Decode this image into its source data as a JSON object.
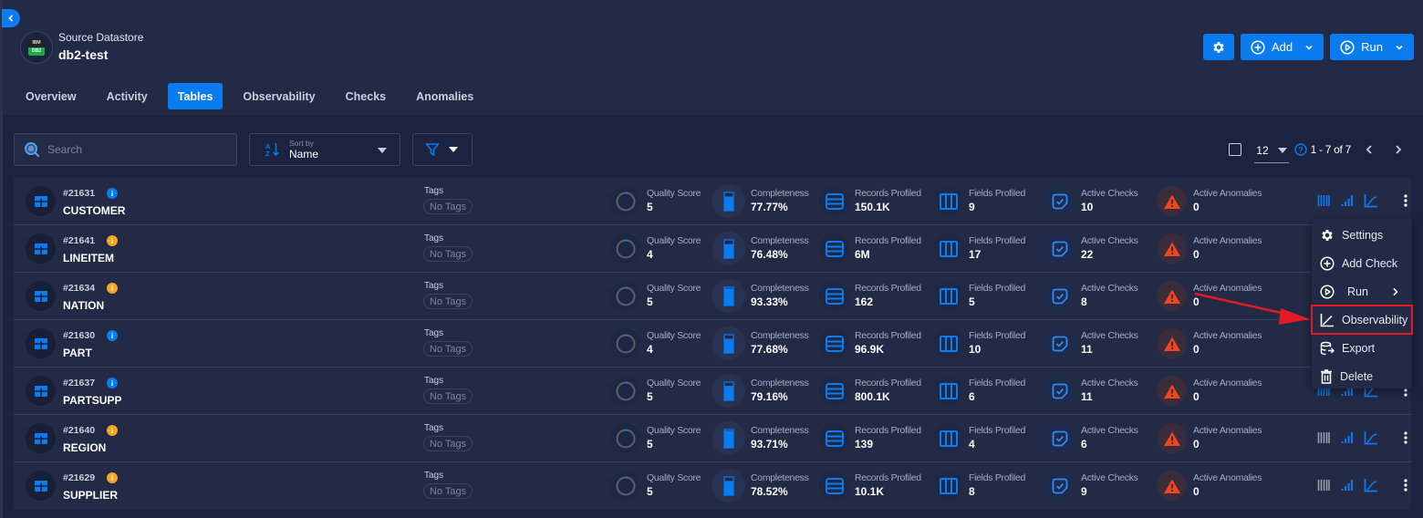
{
  "header": {
    "datastore_label": "Source Datastore",
    "datastore_name": "db2-test",
    "logo": {
      "top": "IBM",
      "bottom": "DB2"
    },
    "buttons": {
      "settings_icon": "gear-icon",
      "add_label": "Add",
      "run_label": "Run"
    }
  },
  "tabs": [
    {
      "label": "Overview",
      "active": false
    },
    {
      "label": "Activity",
      "active": false
    },
    {
      "label": "Tables",
      "active": true
    },
    {
      "label": "Observability",
      "active": false
    },
    {
      "label": "Checks",
      "active": false
    },
    {
      "label": "Anomalies",
      "active": false
    }
  ],
  "toolbar": {
    "search_placeholder": "Search",
    "search_value": "",
    "sort_caption": "Sort by",
    "sort_value": "Name",
    "per_page": "12",
    "range": "1 - 7 of 7"
  },
  "labels": {
    "tags": "Tags",
    "no_tags": "No Tags",
    "quality": "Quality Score",
    "completeness": "Completeness",
    "records": "Records Profiled",
    "fields": "Fields Profiled",
    "checks": "Active Checks",
    "anomalies": "Active Anomalies"
  },
  "colors": {
    "accent": "#0a7cf0",
    "info_blue": "#0a7cf0",
    "info_orange": "#f5a623",
    "warning_red": "#f0441f",
    "highlight_red": "#e01b24"
  },
  "rows": [
    {
      "id": "#21631",
      "name": "CUSTOMER",
      "info": "blue",
      "quality": "5",
      "completeness": "77.77%",
      "records": "150.1K",
      "fields": "9",
      "checks": "10",
      "anomalies": "0",
      "profile_active": true
    },
    {
      "id": "#21641",
      "name": "LINEITEM",
      "info": "orange",
      "quality": "4",
      "completeness": "76.48%",
      "records": "6M",
      "fields": "17",
      "checks": "22",
      "anomalies": "0",
      "profile_active": true
    },
    {
      "id": "#21634",
      "name": "NATION",
      "info": "orange",
      "quality": "5",
      "completeness": "93.33%",
      "records": "162",
      "fields": "5",
      "checks": "8",
      "anomalies": "0",
      "profile_active": true
    },
    {
      "id": "#21630",
      "name": "PART",
      "info": "blue",
      "quality": "4",
      "completeness": "77.68%",
      "records": "96.9K",
      "fields": "10",
      "checks": "11",
      "anomalies": "0",
      "profile_active": true
    },
    {
      "id": "#21637",
      "name": "PARTSUPP",
      "info": "blue",
      "quality": "5",
      "completeness": "79.16%",
      "records": "800.1K",
      "fields": "6",
      "checks": "11",
      "anomalies": "0",
      "profile_active": true
    },
    {
      "id": "#21640",
      "name": "REGION",
      "info": "orange",
      "quality": "5",
      "completeness": "93.71%",
      "records": "139",
      "fields": "4",
      "checks": "6",
      "anomalies": "0",
      "profile_active": false
    },
    {
      "id": "#21629",
      "name": "SUPPLIER",
      "info": "orange",
      "quality": "5",
      "completeness": "78.52%",
      "records": "10.1K",
      "fields": "8",
      "checks": "9",
      "anomalies": "0",
      "profile_active": false
    }
  ],
  "context_menu": {
    "items": [
      {
        "label": "Settings",
        "icon": "gear-icon"
      },
      {
        "label": "Add Check",
        "icon": "plus-circle-icon"
      },
      {
        "label": "Run",
        "icon": "play-circle-icon",
        "submenu": true
      },
      {
        "label": "Observability",
        "icon": "chart-line-icon",
        "highlighted": true
      },
      {
        "label": "Export",
        "icon": "export-icon"
      },
      {
        "label": "Delete",
        "icon": "trash-icon"
      }
    ]
  }
}
